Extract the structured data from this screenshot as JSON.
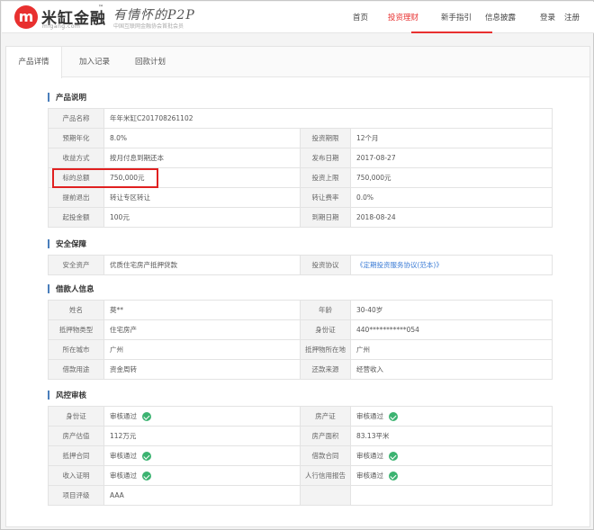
{
  "header": {
    "logo_char": "m",
    "logo_name": "米缸金融",
    "logo_tm": "™",
    "logo_domain": "migang.com",
    "slogan": "有情怀的P2P",
    "slogan_sub": "中国互联网金融协会首批会员",
    "nav": [
      "首页",
      "投资理财",
      "新手指引",
      "信息披露"
    ],
    "nav_active": "投资理财",
    "login": "登录",
    "register": "注册",
    "accent_color": "#e8302f"
  },
  "tabs": [
    "产品详情",
    "加入记录",
    "回款计划"
  ],
  "sections": {
    "product": {
      "title": "产品说明",
      "rows": [
        [
          "产品名称",
          "年年米缸C201708261102"
        ],
        [
          "预期年化",
          "8.0%",
          "投资期限",
          "12个月"
        ],
        [
          "收益方式",
          "按月付息到期还本",
          "发布日期",
          "2017-08-27"
        ],
        [
          "标的总额",
          "750,000元",
          "投资上限",
          "750,000元"
        ],
        [
          "提前退出",
          "转让专区转让",
          "转让费率",
          "0.0%"
        ],
        [
          "起投金额",
          "100元",
          "到期日期",
          "2018-08-24"
        ]
      ]
    },
    "security": {
      "title": "安全保障",
      "rows": [
        [
          "安全资产",
          "优质住宅房产抵押贷款",
          "投资协议",
          "《定期投资服务协议(范本)》"
        ]
      ]
    },
    "borrower": {
      "title": "借款人信息",
      "rows": [
        [
          "姓名",
          "莫**",
          "年龄",
          "30-40岁"
        ],
        [
          "抵押物类型",
          "住宅房产",
          "身份证",
          "440***********054"
        ],
        [
          "所在城市",
          "广州",
          "抵押物所在地",
          "广州"
        ],
        [
          "借款用途",
          "资金周转",
          "还款来源",
          "经营收入"
        ]
      ]
    },
    "risk": {
      "title": "风控审核",
      "rows": [
        [
          "身份证",
          "审核通过",
          "房产证",
          "审核通过"
        ],
        [
          "房产估值",
          "112万元",
          "房产面积",
          "83.13平米"
        ],
        [
          "抵押合同",
          "审核通过",
          "借款合同",
          "审核通过"
        ],
        [
          "收入证明",
          "审核通过",
          "人行信用报告",
          "审核通过"
        ],
        [
          "项目评级",
          "AAA",
          "",
          ""
        ]
      ]
    }
  }
}
